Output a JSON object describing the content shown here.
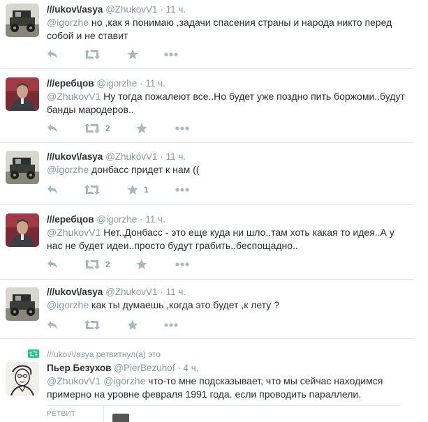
{
  "tweets": [
    {
      "fullname": "///ukov\\/asya",
      "username": "@ZhukovV1",
      "time": "11 ч.",
      "mention": "@igorzhe",
      "text": " но ,как я понимаю ,задачи спасения страны и народа никто перед собой и не ставит",
      "retweet_count": "",
      "favorite_count": "",
      "avatar": "car-avatar"
    },
    {
      "fullname": "///еребцов",
      "username": "@igorzhe",
      "time": "11 ч.",
      "mention": "@ZhukovV1",
      "text": " Ну тогда пожалеют все..Но будет уже поздно пить боржоми..будут банды мародеров..",
      "retweet_count": "2",
      "favorite_count": "",
      "avatar": "man-avatar"
    },
    {
      "fullname": "///ukov\\/asya",
      "username": "@ZhukovV1",
      "time": "11 ч.",
      "mention": "@igorzhe",
      "text": " донбасс придет к нам ((",
      "retweet_count": "",
      "favorite_count": "1",
      "avatar": "car-avatar"
    },
    {
      "fullname": "///еребцов",
      "username": "@igorzhe",
      "time": "11 ч.",
      "mention": "@ZhukovV1",
      "text": " Нет..Донбасс - это еще куда ни шло..там хоть какая то идея..А у нас не будет идеи..просто будут грабить..беспощадно..",
      "retweet_count": "2",
      "favorite_count": "",
      "avatar": "man-avatar"
    },
    {
      "fullname": "///ukov\\/asya",
      "username": "@ZhukovV1",
      "time": "11 ч.",
      "mention": "@igorzhe",
      "text": " как ты думаешь ,когда это будет ,к лету ?",
      "retweet_count": "",
      "favorite_count": "",
      "avatar": "car-avatar"
    }
  ],
  "retweeted": {
    "context": "///ukov\\/asya ретвитнул(а) это",
    "fullname": "Пьер Безухов",
    "username": "@PierBezuhof",
    "time": "4 ч.",
    "mentions": "@ZhukovV1 @igorzhe",
    "text": " что-то мне подсказывает, что мы сейчас находимся примерно на уровне февраля 1991 года. если проводить параллели.",
    "retweets_label": "РЕТВИТ",
    "avatar": "sketch-avatar"
  },
  "dot": "·",
  "colors": {
    "text": "#292f33",
    "muted": "#8899a6",
    "icon": "#aab8c2",
    "retweet_green": "#19cf86",
    "divider": "#e1e8ed"
  }
}
